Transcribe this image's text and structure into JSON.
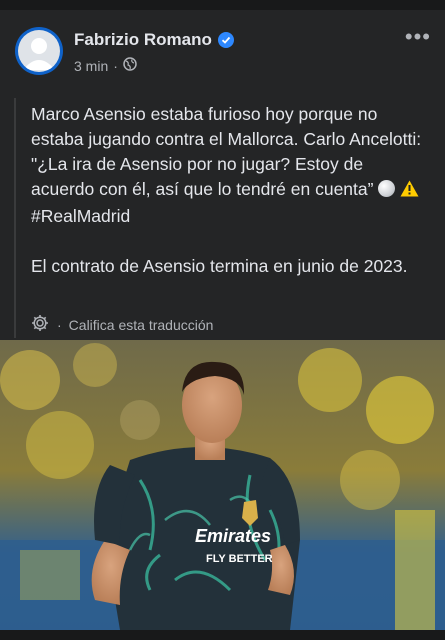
{
  "post": {
    "author": "Fabrizio Romano",
    "verified_icon": "verified-badge-icon",
    "time": "3 min",
    "audience_icon": "globe-icon",
    "more_label": "•••",
    "text_p1_a": "Marco Asensio estaba furioso hoy porque no estaba jugando contra el Mallorca. Carlo Ancelotti: \"¿La ira de Asensio por no jugar? Estoy de acuerdo con él, así que lo tendré en cuenta” ",
    "text_p1_hashtag": "#RealMadrid",
    "text_p2": "El contrato de Asensio termina en junio de 2023.",
    "translate_label": "Califica esta traducción",
    "image_subject": "Real Madrid player warming up",
    "jersey_sponsor_line1": "Emirates",
    "jersey_sponsor_line2": "FLY BETTER"
  },
  "colors": {
    "background": "#242526",
    "text": "#e4e6eb",
    "secondary": "#b0b3b8",
    "accent": "#2d88ff"
  }
}
